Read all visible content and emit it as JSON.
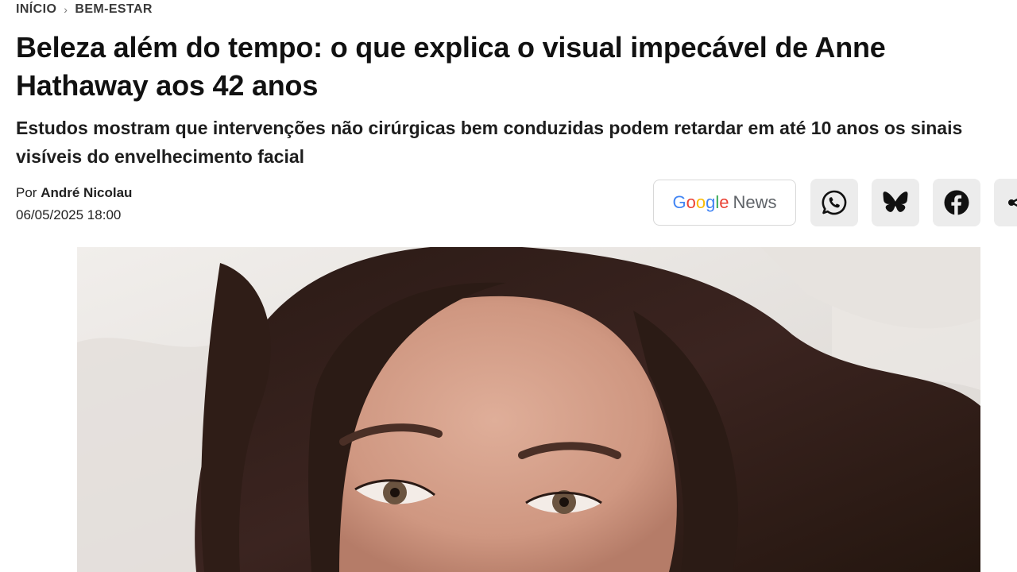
{
  "breadcrumb": {
    "home": "INÍCIO",
    "separator": "›",
    "section": "BEM-ESTAR"
  },
  "article": {
    "title": "Beleza além do tempo: o que explica o visual impecável de Anne Hathaway aos 42 anos",
    "subtitle": "Estudos mostram que intervenções não cirúrgicas bem conduzidas podem retardar em até 10 anos os sinais visíveis do envelhecimento facial",
    "byline_prefix": "Por",
    "author": "André Nicolau",
    "date": "06/05/2025 18:00"
  },
  "share": {
    "google_news": {
      "letters": [
        "G",
        "o",
        "o",
        "g",
        "l",
        "e"
      ],
      "letter_colors": [
        "#4285F4",
        "#EA4335",
        "#FBBC05",
        "#4285F4",
        "#34A853",
        "#EA4335"
      ],
      "news": "News"
    },
    "buttons": [
      {
        "icon": "whatsapp-icon"
      },
      {
        "icon": "bluesky-icon"
      },
      {
        "icon": "facebook-icon"
      },
      {
        "icon": "share-icon"
      }
    ]
  },
  "colors": {
    "text": "#111111",
    "button_bg": "#ececec",
    "border": "#d8d8d8"
  }
}
